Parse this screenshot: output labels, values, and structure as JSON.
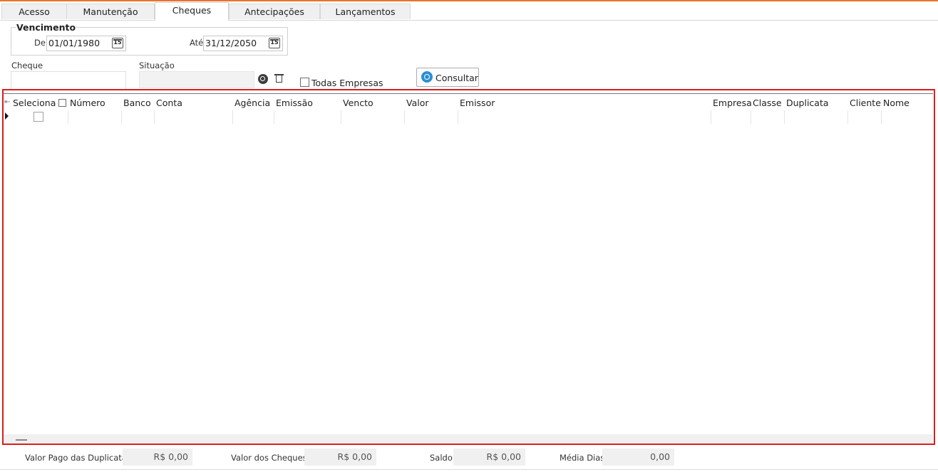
{
  "tabs": [
    "Acesso",
    "Manutenção",
    "Cheques",
    "Antecipações",
    "Lançamentos"
  ],
  "active_tab": "Cheques",
  "vencimento": {
    "title": "Vencimento",
    "de_label": "De",
    "de_value": "01/01/1980",
    "ate_label": "Até",
    "ate_value": "31/12/2050",
    "calendar_glyph": "15"
  },
  "filters": {
    "cheque_label": "Cheque",
    "situacao_label": "Situação",
    "todas_empresas_label": "Todas Empresas",
    "consultar_label": "Consultar"
  },
  "grid": {
    "columns": [
      "Seleciona",
      "Número",
      "Banco",
      "Conta",
      "Agência",
      "Emissão",
      "Vencto",
      "Valor",
      "Emissor",
      "Empresa",
      "Classe",
      "Duplicata",
      "Cliente",
      "Nome"
    ]
  },
  "footer": {
    "valor_pago_label": "Valor Pago das Duplicatas",
    "valor_pago_value": "R$ 0,00",
    "valor_cheques_label": "Valor dos Cheques",
    "valor_cheques_value": "R$ 0,00",
    "saldo_label": "Saldo",
    "saldo_value": "R$ 0,00",
    "media_dias_label": "Média Dias",
    "media_dias_value": "0,00"
  },
  "colors": {
    "accent": "#e8742c",
    "highlight_border": "#dd1c1c",
    "button_icon": "#2b8fd6"
  }
}
